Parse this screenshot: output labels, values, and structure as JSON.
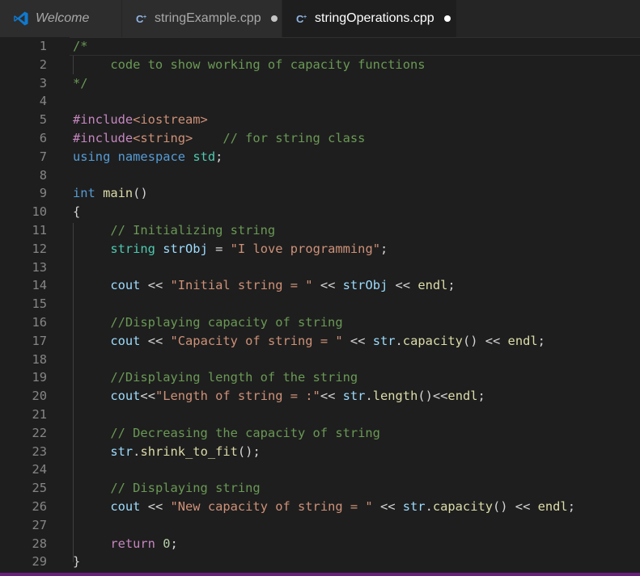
{
  "tabs": [
    {
      "label": "Welcome",
      "icon": "vscode-logo-icon",
      "dirty": false,
      "active": false
    },
    {
      "label": "stringExample.cpp",
      "icon": "cpp-file-icon",
      "dirty": true,
      "active": false
    },
    {
      "label": "stringOperations.cpp",
      "icon": "cpp-file-icon",
      "dirty": true,
      "active": true
    }
  ],
  "colors": {
    "comment": "#6a9955",
    "keyword": "#569cd6",
    "string": "#ce9178",
    "function": "#dcdcaa",
    "variable": "#9cdcfe",
    "preprocessor": "#c586c0",
    "number": "#b5cea8",
    "plain": "#d4d4d4",
    "line_number": "#858585"
  },
  "lines": [
    {
      "n": "1",
      "tokens": [
        {
          "t": "/*",
          "c": "cm"
        }
      ]
    },
    {
      "n": "2",
      "tokens": [
        {
          "t": "     code to show working of capacity functions",
          "c": "cm"
        }
      ]
    },
    {
      "n": "3",
      "tokens": [
        {
          "t": "*/",
          "c": "cm"
        }
      ]
    },
    {
      "n": "4",
      "tokens": []
    },
    {
      "n": "5",
      "tokens": [
        {
          "t": "#include",
          "c": "pp"
        },
        {
          "t": "<iostream>",
          "c": "inc"
        }
      ]
    },
    {
      "n": "6",
      "tokens": [
        {
          "t": "#include",
          "c": "pp"
        },
        {
          "t": "<string>",
          "c": "inc"
        },
        {
          "t": "    ",
          "c": "pn"
        },
        {
          "t": "// for string class",
          "c": "cm"
        }
      ]
    },
    {
      "n": "7",
      "tokens": [
        {
          "t": "using",
          "c": "kw"
        },
        {
          "t": " ",
          "c": "pn"
        },
        {
          "t": "namespace",
          "c": "kw"
        },
        {
          "t": " ",
          "c": "pn"
        },
        {
          "t": "std",
          "c": "ty"
        },
        {
          "t": ";",
          "c": "pn"
        }
      ]
    },
    {
      "n": "8",
      "tokens": []
    },
    {
      "n": "9",
      "tokens": [
        {
          "t": "int",
          "c": "kw"
        },
        {
          "t": " ",
          "c": "pn"
        },
        {
          "t": "main",
          "c": "fn"
        },
        {
          "t": "()",
          "c": "pn"
        }
      ]
    },
    {
      "n": "10",
      "tokens": [
        {
          "t": "{",
          "c": "pn"
        }
      ]
    },
    {
      "n": "11",
      "tokens": [
        {
          "t": "     ",
          "c": "pn"
        },
        {
          "t": "// Initializing string",
          "c": "cm"
        }
      ]
    },
    {
      "n": "12",
      "tokens": [
        {
          "t": "     ",
          "c": "pn"
        },
        {
          "t": "string",
          "c": "ty"
        },
        {
          "t": " ",
          "c": "pn"
        },
        {
          "t": "strObj",
          "c": "var"
        },
        {
          "t": " = ",
          "c": "pn"
        },
        {
          "t": "\"I love programming\"",
          "c": "str"
        },
        {
          "t": ";",
          "c": "pn"
        }
      ]
    },
    {
      "n": "13",
      "tokens": []
    },
    {
      "n": "14",
      "tokens": [
        {
          "t": "     ",
          "c": "pn"
        },
        {
          "t": "cout",
          "c": "var"
        },
        {
          "t": " << ",
          "c": "pn"
        },
        {
          "t": "\"Initial string = \"",
          "c": "str"
        },
        {
          "t": " << ",
          "c": "pn"
        },
        {
          "t": "strObj",
          "c": "var"
        },
        {
          "t": " << ",
          "c": "pn"
        },
        {
          "t": "endl",
          "c": "fn"
        },
        {
          "t": ";",
          "c": "pn"
        }
      ]
    },
    {
      "n": "15",
      "tokens": []
    },
    {
      "n": "16",
      "tokens": [
        {
          "t": "     ",
          "c": "pn"
        },
        {
          "t": "//Displaying capacity of string",
          "c": "cm"
        }
      ]
    },
    {
      "n": "17",
      "tokens": [
        {
          "t": "     ",
          "c": "pn"
        },
        {
          "t": "cout",
          "c": "var"
        },
        {
          "t": " << ",
          "c": "pn"
        },
        {
          "t": "\"Capacity of string = \"",
          "c": "str"
        },
        {
          "t": " << ",
          "c": "pn"
        },
        {
          "t": "str",
          "c": "var"
        },
        {
          "t": ".",
          "c": "pn"
        },
        {
          "t": "capacity",
          "c": "fn"
        },
        {
          "t": "() << ",
          "c": "pn"
        },
        {
          "t": "endl",
          "c": "fn"
        },
        {
          "t": ";",
          "c": "pn"
        }
      ]
    },
    {
      "n": "18",
      "tokens": []
    },
    {
      "n": "19",
      "tokens": [
        {
          "t": "     ",
          "c": "pn"
        },
        {
          "t": "//Displaying length of the string",
          "c": "cm"
        }
      ]
    },
    {
      "n": "20",
      "tokens": [
        {
          "t": "     ",
          "c": "pn"
        },
        {
          "t": "cout",
          "c": "var"
        },
        {
          "t": "<<",
          "c": "pn"
        },
        {
          "t": "\"Length of string = :\"",
          "c": "str"
        },
        {
          "t": "<< ",
          "c": "pn"
        },
        {
          "t": "str",
          "c": "var"
        },
        {
          "t": ".",
          "c": "pn"
        },
        {
          "t": "length",
          "c": "fn"
        },
        {
          "t": "()<<",
          "c": "pn"
        },
        {
          "t": "endl",
          "c": "fn"
        },
        {
          "t": ";",
          "c": "pn"
        }
      ]
    },
    {
      "n": "21",
      "tokens": []
    },
    {
      "n": "22",
      "tokens": [
        {
          "t": "     ",
          "c": "pn"
        },
        {
          "t": "// Decreasing the capacity of string",
          "c": "cm"
        }
      ]
    },
    {
      "n": "23",
      "tokens": [
        {
          "t": "     ",
          "c": "pn"
        },
        {
          "t": "str",
          "c": "var"
        },
        {
          "t": ".",
          "c": "pn"
        },
        {
          "t": "shrink_to_fit",
          "c": "fn"
        },
        {
          "t": "();",
          "c": "pn"
        }
      ]
    },
    {
      "n": "24",
      "tokens": []
    },
    {
      "n": "25",
      "tokens": [
        {
          "t": "     ",
          "c": "pn"
        },
        {
          "t": "// Displaying string",
          "c": "cm"
        }
      ]
    },
    {
      "n": "26",
      "tokens": [
        {
          "t": "     ",
          "c": "pn"
        },
        {
          "t": "cout",
          "c": "var"
        },
        {
          "t": " << ",
          "c": "pn"
        },
        {
          "t": "\"New capacity of string = \"",
          "c": "str"
        },
        {
          "t": " << ",
          "c": "pn"
        },
        {
          "t": "str",
          "c": "var"
        },
        {
          "t": ".",
          "c": "pn"
        },
        {
          "t": "capacity",
          "c": "fn"
        },
        {
          "t": "() << ",
          "c": "pn"
        },
        {
          "t": "endl",
          "c": "fn"
        },
        {
          "t": ";",
          "c": "pn"
        }
      ]
    },
    {
      "n": "27",
      "tokens": []
    },
    {
      "n": "28",
      "tokens": [
        {
          "t": "     ",
          "c": "pn"
        },
        {
          "t": "return",
          "c": "ret"
        },
        {
          "t": " ",
          "c": "pn"
        },
        {
          "t": "0",
          "c": "num"
        },
        {
          "t": ";",
          "c": "pn"
        }
      ]
    },
    {
      "n": "29",
      "tokens": [
        {
          "t": "}",
          "c": "pn"
        }
      ]
    }
  ]
}
